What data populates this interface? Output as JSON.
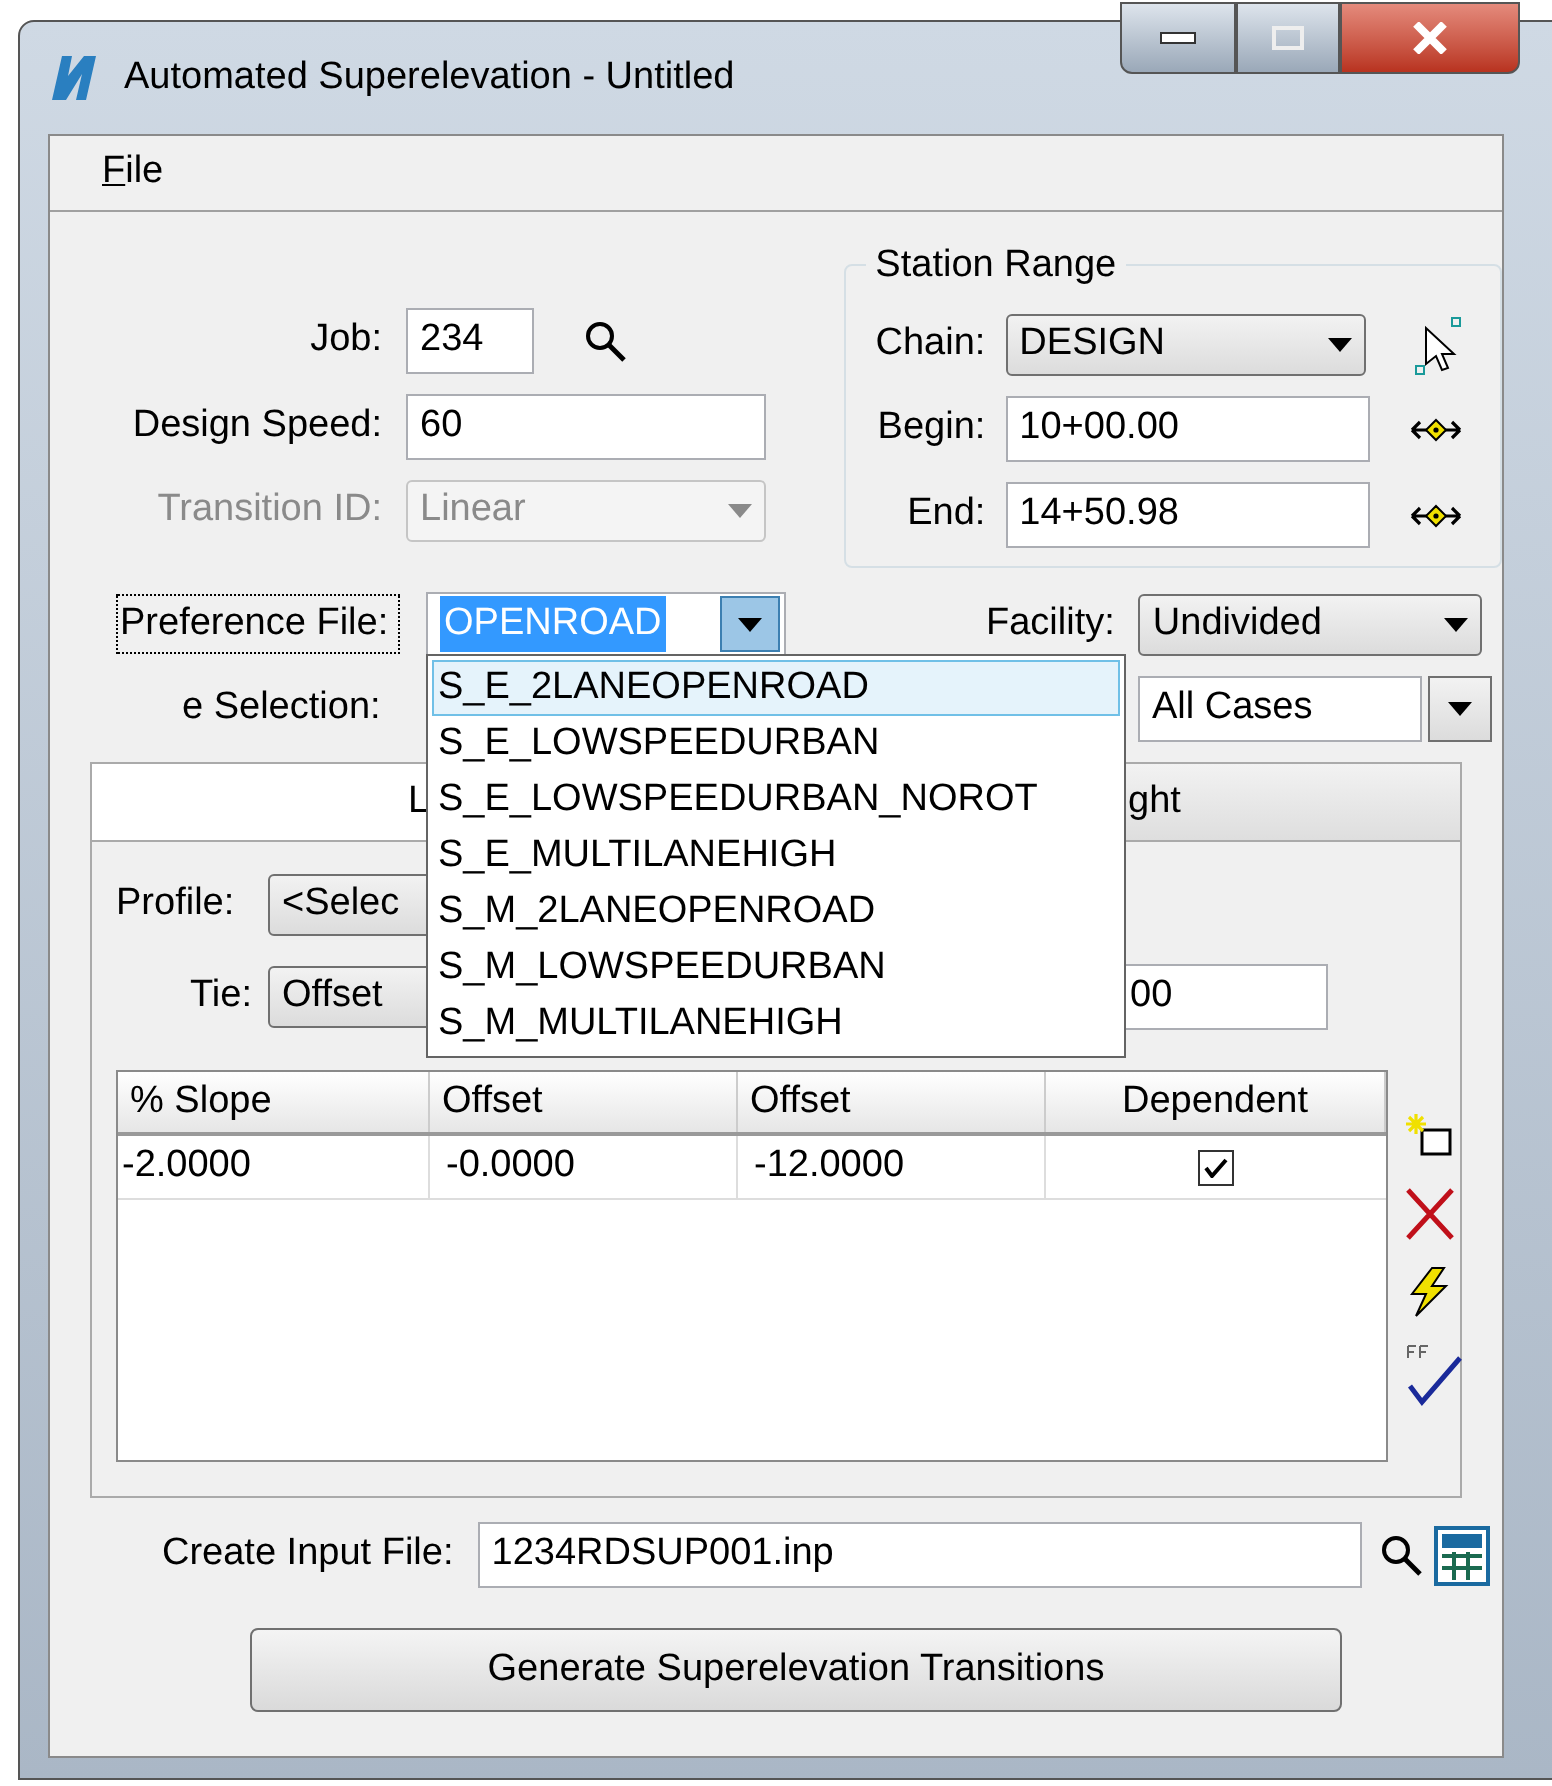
{
  "window": {
    "title": "Automated Superelevation - Untitled"
  },
  "menu": [
    {
      "label": "File"
    }
  ],
  "job": {
    "label": "Job:",
    "value": "234"
  },
  "design_speed": {
    "label": "Design Speed:",
    "value": "60"
  },
  "transition_id": {
    "label": "Transition ID:",
    "value": "Linear",
    "disabled": true
  },
  "station_range": {
    "title": "Station Range",
    "chain": {
      "label": "Chain:",
      "value": "DESIGN"
    },
    "begin": {
      "label": "Begin:",
      "value": "10+00.00"
    },
    "end": {
      "label": "End:",
      "value": "14+50.98"
    }
  },
  "preference_file": {
    "label": "Preference File:",
    "value": "OPENROAD",
    "expanded": true,
    "options": [
      {
        "label": "S_E_2LANEOPENROAD",
        "selected": true
      },
      {
        "label": "S_E_LOWSPEEDURBAN",
        "selected": false
      },
      {
        "label": "S_E_LOWSPEEDURBAN_NOROT",
        "selected": false
      },
      {
        "label": "S_E_MULTILANEHIGH",
        "selected": false
      },
      {
        "label": "S_M_2LANEOPENROAD",
        "selected": false
      },
      {
        "label": "S_M_LOWSPEEDURBAN",
        "selected": false
      },
      {
        "label": "S_M_MULTILANEHIGH",
        "selected": false
      }
    ]
  },
  "facility": {
    "label": "Facility:",
    "value": "Undivided"
  },
  "e_selection": {
    "label": "e Selection:",
    "value": "All Cases"
  },
  "tabs": [
    {
      "label": "L",
      "selected": true
    },
    {
      "label": "ght",
      "selected": false
    }
  ],
  "profile": {
    "label": "Profile:",
    "value": "<Selec"
  },
  "tie": {
    "label": "Tie:",
    "value": "Offset",
    "field_value": "00"
  },
  "table": {
    "columns": [
      "% Slope",
      "Offset",
      "Offset",
      "Dependent"
    ],
    "rows": [
      {
        "cells": [
          "-2.0000",
          "-0.0000",
          "-12.0000"
        ],
        "dependent": true
      }
    ]
  },
  "create_input_file": {
    "label": "Create Input File:",
    "value": "1234RDSUP001.inp"
  },
  "generate_button": {
    "label": "Generate Superelevation Transitions"
  }
}
